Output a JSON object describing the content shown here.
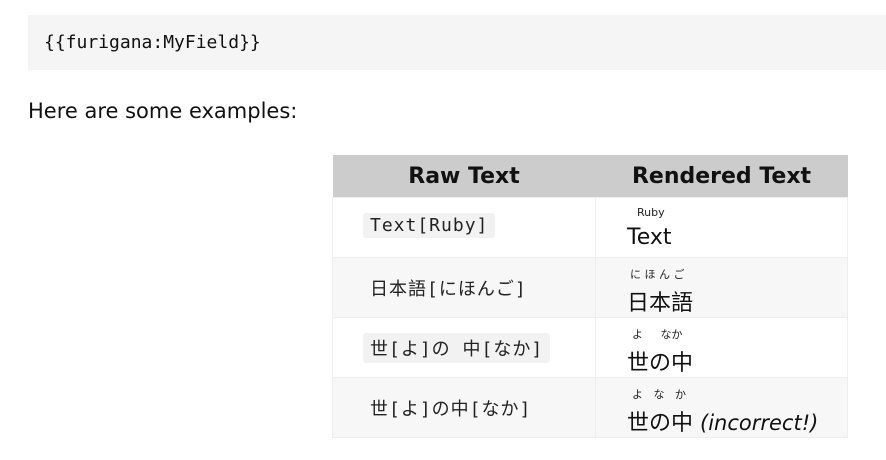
{
  "code_block": "{{furigana:MyField}}",
  "intro": "Here are some examples:",
  "table": {
    "headers": [
      "Raw Text",
      "Rendered Text"
    ],
    "rows": [
      {
        "raw": "Text[Ruby]",
        "ruby": "Ruby",
        "base": "Text",
        "note": ""
      },
      {
        "raw": "日本語[にほんご]",
        "ruby": "に ほ ん ご",
        "base": "日本語",
        "note": ""
      },
      {
        "raw": "世[よ]の 中[なか]",
        "ruby": "よ     なか",
        "base": "世の中",
        "note": ""
      },
      {
        "raw": "世[よ]の中[なか]",
        "ruby": "よ   な   か",
        "base": "世の中",
        "note": "(incorrect!)"
      }
    ]
  }
}
